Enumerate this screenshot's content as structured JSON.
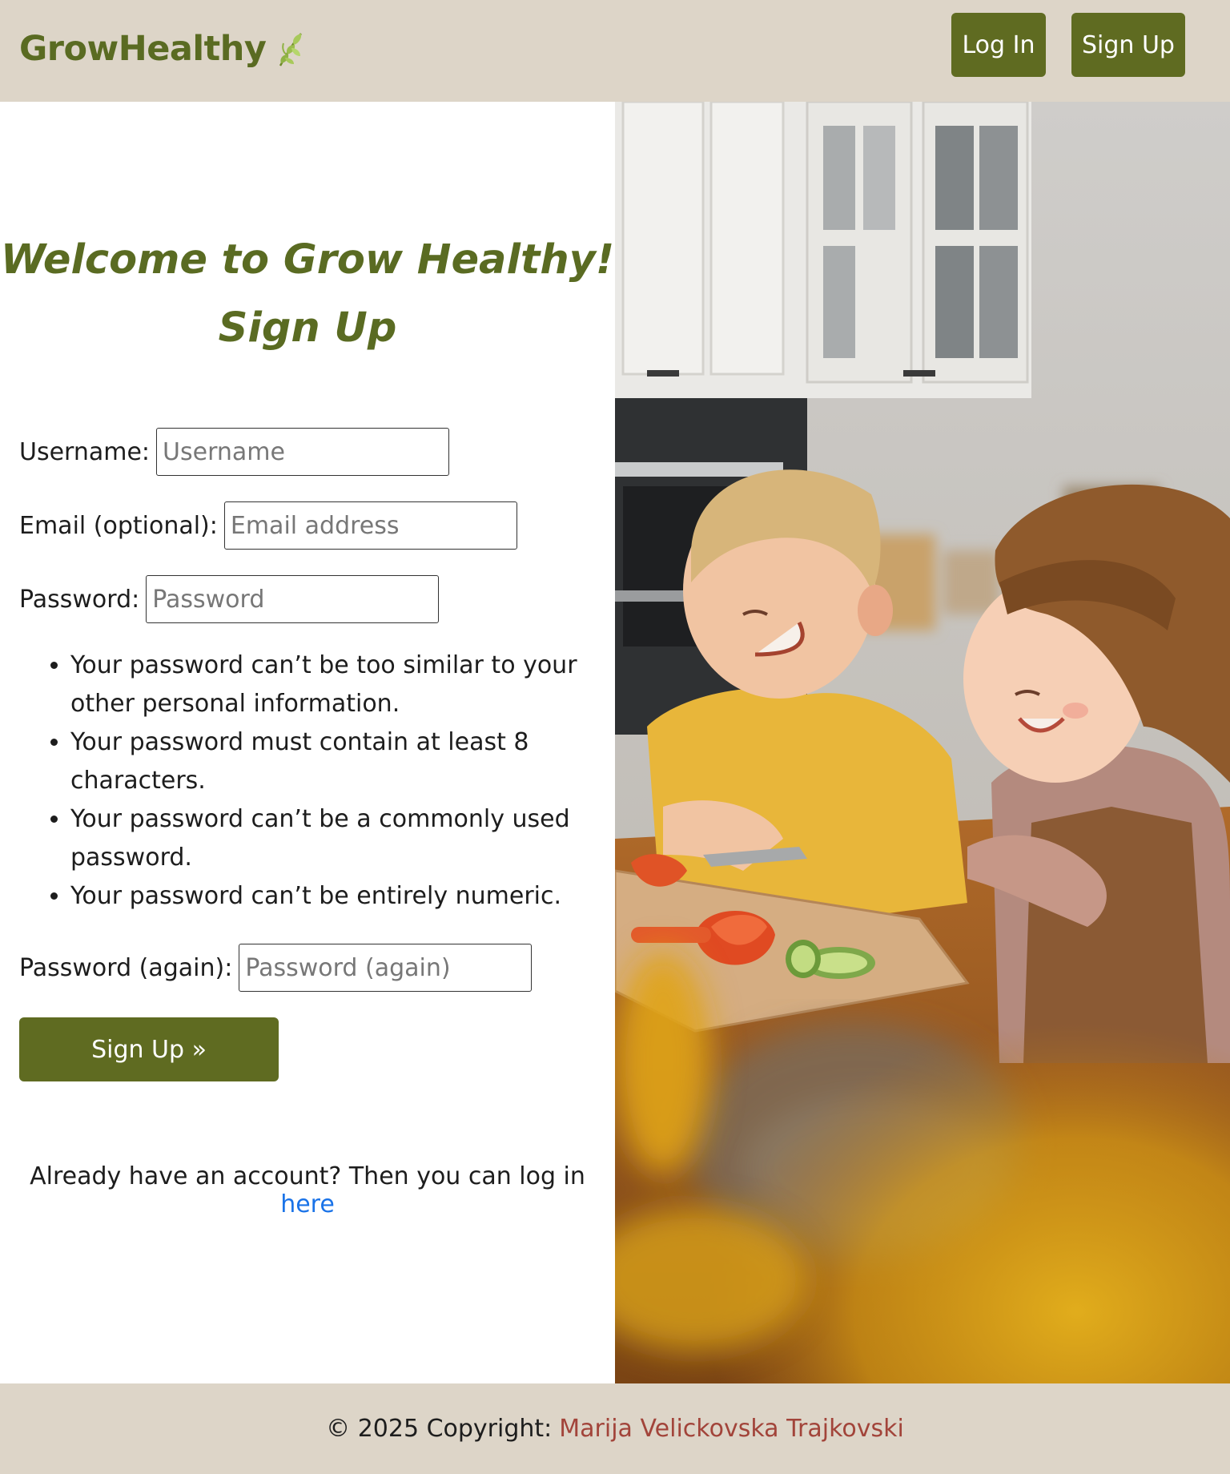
{
  "header": {
    "brand": "GrowHealthy",
    "brand_icon": "leaf-icon",
    "login_label": "Log In",
    "signup_label": "Sign Up"
  },
  "main": {
    "title": "Welcome to Grow Healthy!",
    "subtitle": "Sign Up",
    "fields": {
      "username": {
        "label": "Username:",
        "placeholder": "Username",
        "value": ""
      },
      "email": {
        "label": "Email (optional):",
        "placeholder": "Email address",
        "value": ""
      },
      "password": {
        "label": "Password:",
        "placeholder": "Password",
        "value": ""
      },
      "password_again": {
        "label": "Password (again):",
        "placeholder": "Password (again)",
        "value": ""
      }
    },
    "password_rules": [
      "Your password can’t be too similar to your other personal information.",
      "Your password must contain at least 8 characters.",
      "Your password can’t be a commonly used password.",
      "Your password can’t be entirely numeric."
    ],
    "submit_label": "Sign Up »",
    "login_hint": "Already have an account? Then you can log in",
    "login_link": "here"
  },
  "photo": {
    "subject": "two-children-cooking-photo"
  },
  "footer": {
    "copyright": "© 2025 Copyright:",
    "author": "Marija Velickovska Trajkovski"
  },
  "colors": {
    "brand_green": "#5f6b21",
    "header_bg": "#ddd5c8",
    "link_blue": "#1a73e8",
    "author_red": "#a2443a"
  }
}
